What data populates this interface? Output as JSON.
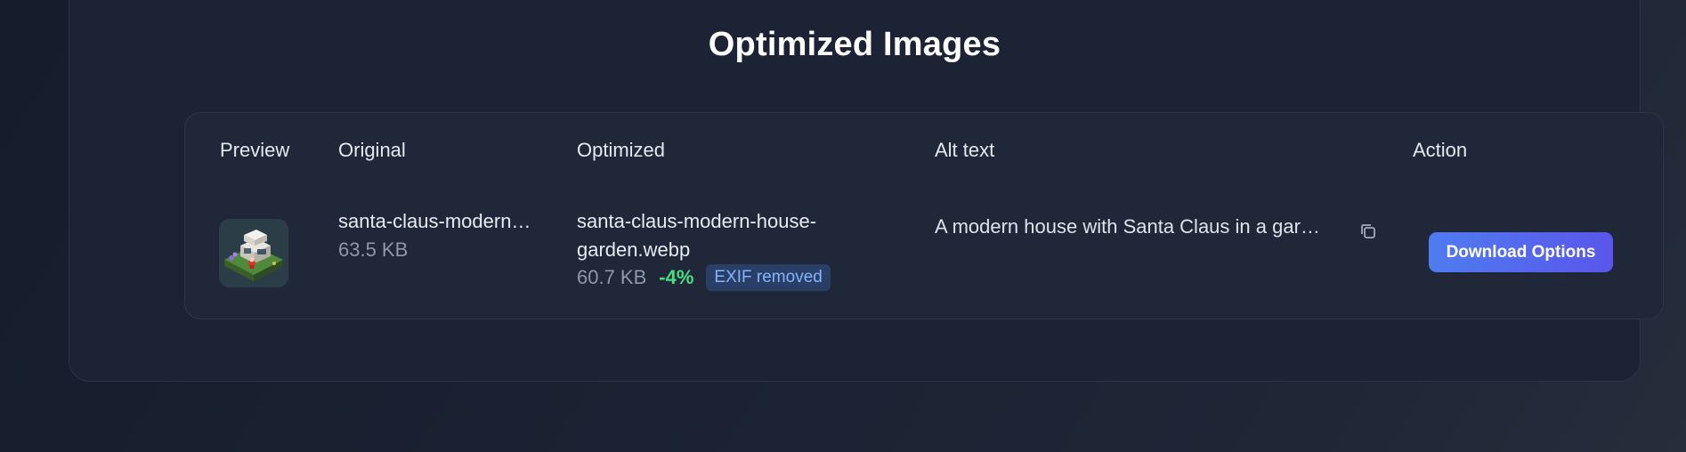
{
  "section": {
    "title": "Optimized Images"
  },
  "table": {
    "headers": {
      "preview": "Preview",
      "original": "Original",
      "optimized": "Optimized",
      "alt_text": "Alt text",
      "action": "Action"
    },
    "rows": [
      {
        "original_name": "santa-claus-modern…",
        "original_size": "63.5 KB",
        "optimized_name_line1": "santa-claus-modern-house-",
        "optimized_name_line2": "garden.webp",
        "optimized_size": "60.7 KB",
        "reduction": "-4%",
        "exif_badge": "EXIF removed",
        "alt_text": "A modern house with Santa Claus in a gar…",
        "action_label": "Download Options"
      }
    ]
  },
  "colors": {
    "background": "#1b2233",
    "panel": "#1c2334",
    "accent_button_start": "#4f7cf0",
    "accent_button_end": "#5a56ea",
    "reduction_green": "#4ade80",
    "badge_bg": "#2a3f66",
    "badge_text": "#84b4ff"
  },
  "icons": {
    "copy": "copy-icon",
    "preview": "preview-thumbnail"
  }
}
